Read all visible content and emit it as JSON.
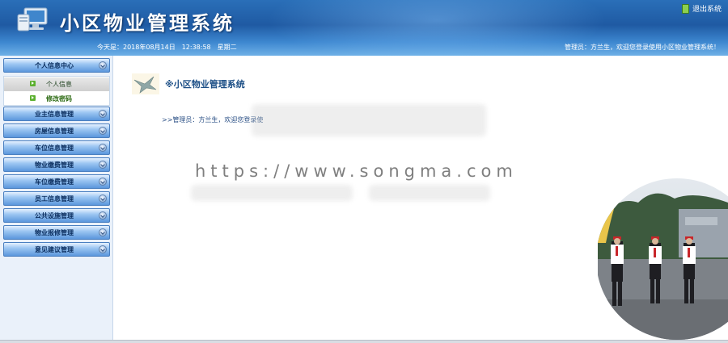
{
  "header": {
    "app_title": "小区物业管理系统",
    "logout_label": "退出系统",
    "date_text": "今天是：2018年08月14日　12:38:58　星期二",
    "welcome_text": "管理员：方兰生，欢迎您登录使用小区物业管理系统！"
  },
  "sidebar": {
    "menus": [
      {
        "label": "个人信息中心"
      },
      {
        "label": "业主信息管理"
      },
      {
        "label": "房屋信息管理"
      },
      {
        "label": "车位信息管理"
      },
      {
        "label": "物业缴费管理"
      },
      {
        "label": "车位缴费管理"
      },
      {
        "label": "员工信息管理"
      },
      {
        "label": "公共设施管理"
      },
      {
        "label": "物业报修管理"
      },
      {
        "label": "意见建议管理"
      }
    ],
    "submenu": [
      {
        "label": "个人信息"
      },
      {
        "label": "修改密码"
      }
    ]
  },
  "main": {
    "title": "※小区物业管理系统",
    "greeting": ">>管理员：方兰生，欢迎您登录使",
    "watermark": "https://www.songma.com"
  },
  "colors": {
    "header_blue": "#1f5aa3",
    "menu_blue": "#5b97dc",
    "title_blue": "#1b4e86"
  }
}
